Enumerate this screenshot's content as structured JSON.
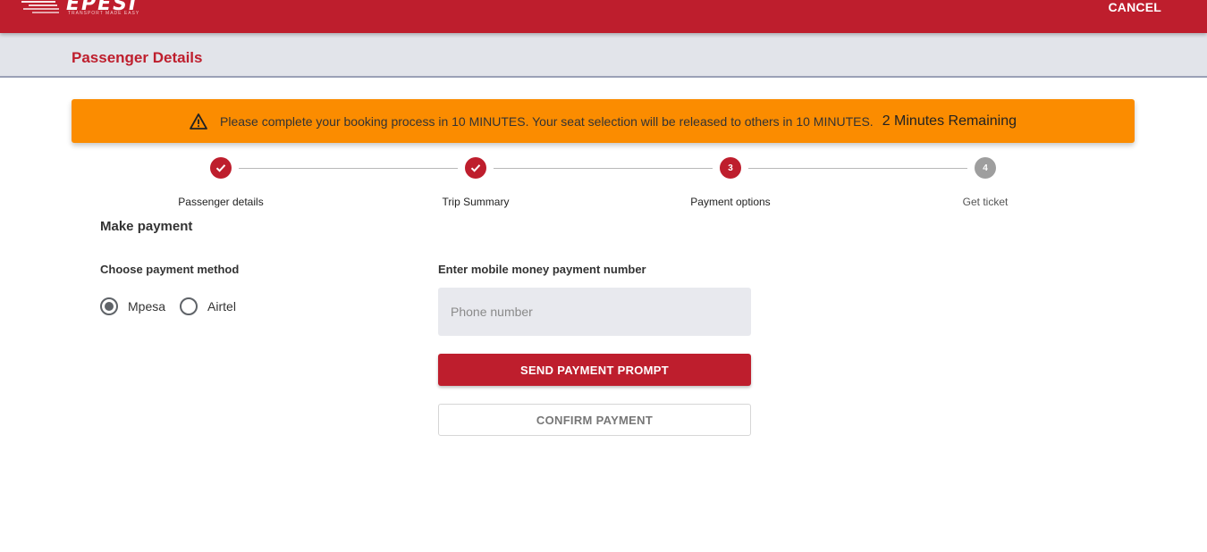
{
  "header": {
    "logo_text": "EPESI",
    "logo_tagline": "TRANSPORT MADE EASY",
    "cancel_label": "CANCEL"
  },
  "subheader": {
    "title": "Passenger Details"
  },
  "alert": {
    "icon": "warning-icon",
    "message": "Please complete your booking process in 10 MINUTES. Your seat selection will be released to others in 10 MINUTES.",
    "remaining": "2 Minutes Remaining"
  },
  "stepper": {
    "steps": [
      {
        "number": "1",
        "label": "Passenger details",
        "state": "done"
      },
      {
        "number": "2",
        "label": "Trip Summary",
        "state": "done"
      },
      {
        "number": "3",
        "label": "Payment options",
        "state": "active"
      },
      {
        "number": "4",
        "label": "Get ticket",
        "state": "todo"
      }
    ]
  },
  "payment": {
    "section_title": "Make payment",
    "method_label": "Choose payment method",
    "methods": [
      {
        "label": "Mpesa",
        "selected": true
      },
      {
        "label": "Airtel",
        "selected": false
      }
    ],
    "phone_label": "Enter mobile money payment number",
    "phone_value": "",
    "phone_placeholder": "Phone number",
    "send_button": "SEND PAYMENT PROMPT",
    "confirm_button": "CONFIRM PAYMENT"
  },
  "colors": {
    "brand": "#be1e2d",
    "alert": "#fb8c00",
    "subheader_bg": "#e2e4ea",
    "step_inactive": "#9e9e9e"
  }
}
